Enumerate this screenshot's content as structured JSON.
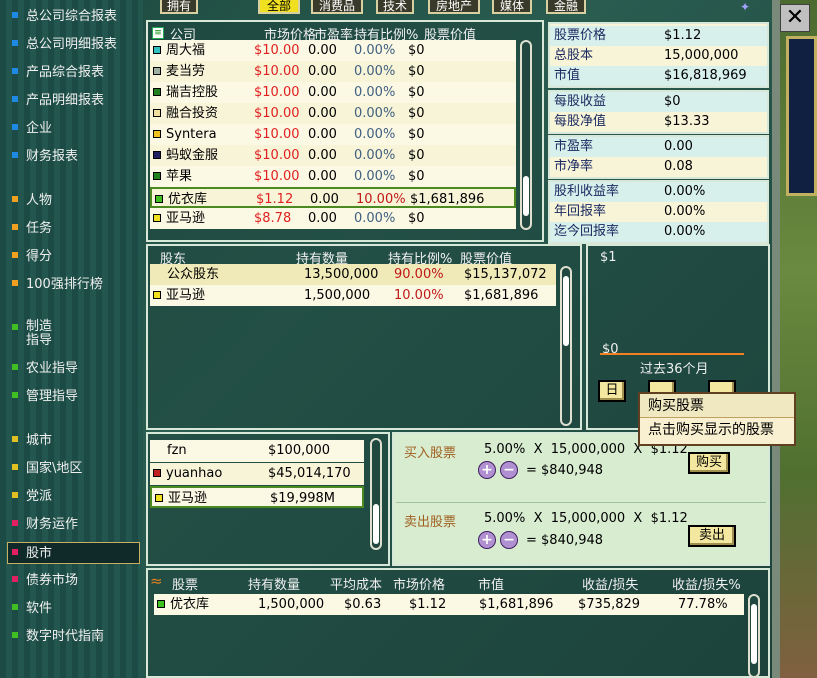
{
  "nav": [
    {
      "label": "总公司综合报表",
      "color": "#1e88e5"
    },
    {
      "label": "总公司明细报表",
      "color": "#1e88e5"
    },
    {
      "label": "产品综合报表",
      "color": "#1e88e5"
    },
    {
      "label": "产品明细报表",
      "color": "#1e88e5"
    },
    {
      "label": "企业",
      "color": "#1e88e5"
    },
    {
      "label": "财务报表",
      "color": "#1e88e5"
    },
    {
      "label": "人物",
      "color": "#f0a020"
    },
    {
      "label": "任务",
      "color": "#f0a020"
    },
    {
      "label": "得分",
      "color": "#f0a020"
    },
    {
      "label": "100强排行榜",
      "color": "#f0a020"
    },
    {
      "label": "制造\n指导",
      "color": "#40c020"
    },
    {
      "label": "农业指导",
      "color": "#40c020"
    },
    {
      "label": "管理指导",
      "color": "#40c020"
    },
    {
      "label": "城市",
      "color": "#e0c020"
    },
    {
      "label": "国家\\地区",
      "color": "#e0c020"
    },
    {
      "label": "党派",
      "color": "#e0c020"
    },
    {
      "label": "财务运作",
      "color": "#e02060"
    },
    {
      "label": "股市",
      "color": "#e02060"
    },
    {
      "label": "债券市场",
      "color": "#e02060"
    },
    {
      "label": "软件",
      "color": "#40c020"
    },
    {
      "label": "数字时代指南",
      "color": "#40c020"
    }
  ],
  "tabs": [
    "拥有",
    "全部",
    "消费品",
    "技术",
    "房地产",
    "媒体",
    "金融"
  ],
  "companies": {
    "headers": [
      "公司",
      "市场价格",
      "市盈率",
      "持有比例%",
      "股票价值"
    ],
    "rows": [
      {
        "name": "周大福",
        "chip": "#30c0c0",
        "price": "$10.00",
        "pe": "0.00",
        "pct": "0.00%",
        "value": "$0"
      },
      {
        "name": "麦当劳",
        "chip": "#a0b0a0",
        "price": "$10.00",
        "pe": "0.00",
        "pct": "0.00%",
        "value": "$0"
      },
      {
        "name": "瑞吉控股",
        "chip": "#208020",
        "price": "$10.00",
        "pe": "0.00",
        "pct": "0.00%",
        "value": "$0"
      },
      {
        "name": "融合投资",
        "chip": "#f0e0a0",
        "price": "$10.00",
        "pe": "0.00",
        "pct": "0.00%",
        "value": "$0"
      },
      {
        "name": "Syntera",
        "chip": "#f0c020",
        "price": "$10.00",
        "pe": "0.00",
        "pct": "0.00%",
        "value": "$0"
      },
      {
        "name": "蚂蚁金服",
        "chip": "#202060",
        "price": "$10.00",
        "pe": "0.00",
        "pct": "0.00%",
        "value": "$0"
      },
      {
        "name": "苹果",
        "chip": "#208020",
        "price": "$10.00",
        "pe": "0.00",
        "pct": "0.00%",
        "value": "$0"
      },
      {
        "name": "优衣库",
        "chip": "#40c020",
        "price": "$1.12",
        "pe": "0.00",
        "pct": "10.00%",
        "value": "$1,681,896"
      },
      {
        "name": "亚马逊",
        "chip": "#f0e020",
        "price": "$8.78",
        "pe": "0.00",
        "pct": "0.00%",
        "value": "$0"
      }
    ]
  },
  "stock_info": {
    "g1": [
      {
        "k": "股票价格",
        "v": "$1.12"
      },
      {
        "k": "总股本",
        "v": "15,000,000"
      },
      {
        "k": "市值",
        "v": "$16,818,969"
      }
    ],
    "g2": [
      {
        "k": "每股收益",
        "v": "$0"
      },
      {
        "k": "每股净值",
        "v": "$13.33"
      }
    ],
    "g3": [
      {
        "k": "市盈率",
        "v": "0.00"
      },
      {
        "k": "市净率",
        "v": "0.08"
      }
    ],
    "g4": [
      {
        "k": "股利收益率",
        "v": "0.00%"
      },
      {
        "k": "年回报率",
        "v": "0.00%"
      },
      {
        "k": "迄今回报率",
        "v": "0.00%"
      }
    ]
  },
  "shareholders": {
    "headers": [
      "股东",
      "持有数量",
      "持有比例%",
      "股票价值"
    ],
    "rows": [
      {
        "name": "公众股东",
        "chip": "",
        "qty": "13,500,000",
        "pct": "90.00%",
        "value": "$15,137,072"
      },
      {
        "name": "亚马逊",
        "chip": "#f0e020",
        "qty": "1,500,000",
        "pct": "10.00%",
        "value": "$1,681,896"
      }
    ]
  },
  "chart": {
    "top_label": "$1",
    "bottom_label": "$0",
    "period": "过去36个月",
    "btn_day": "日"
  },
  "context_menu": [
    "购买股票",
    "点击购买显示的股票"
  ],
  "players": [
    {
      "name": "fzn",
      "chip": "",
      "cash": "$100,000"
    },
    {
      "name": "yuanhao",
      "chip": "#c02020",
      "cash": "$45,014,170"
    },
    {
      "name": "亚马逊",
      "chip": "#f0e020",
      "cash": "$19,998M"
    }
  ],
  "trade": {
    "buy_label": "买入股票",
    "sell_label": "卖出股票",
    "buy_formula": "5.00%  X  15,000,000  X  $1.12",
    "buy_total": "= $840,948",
    "sell_formula": "5.00%  X  15,000,000  X  $1.12",
    "sell_total": "= $840,948",
    "buy_btn": "购买",
    "sell_btn": "卖出"
  },
  "holdings": {
    "headers": [
      "股票",
      "持有数量",
      "平均成本",
      "市场价格",
      "市值",
      "收益/损失",
      "收益/损失%"
    ],
    "rows": [
      {
        "name": "优衣库",
        "chip": "#40c020",
        "qty": "1,500,000",
        "avg": "$0.63",
        "price": "$1.12",
        "mv": "$1,681,896",
        "pl": "$735,829",
        "plpct": "77.78%"
      }
    ]
  }
}
